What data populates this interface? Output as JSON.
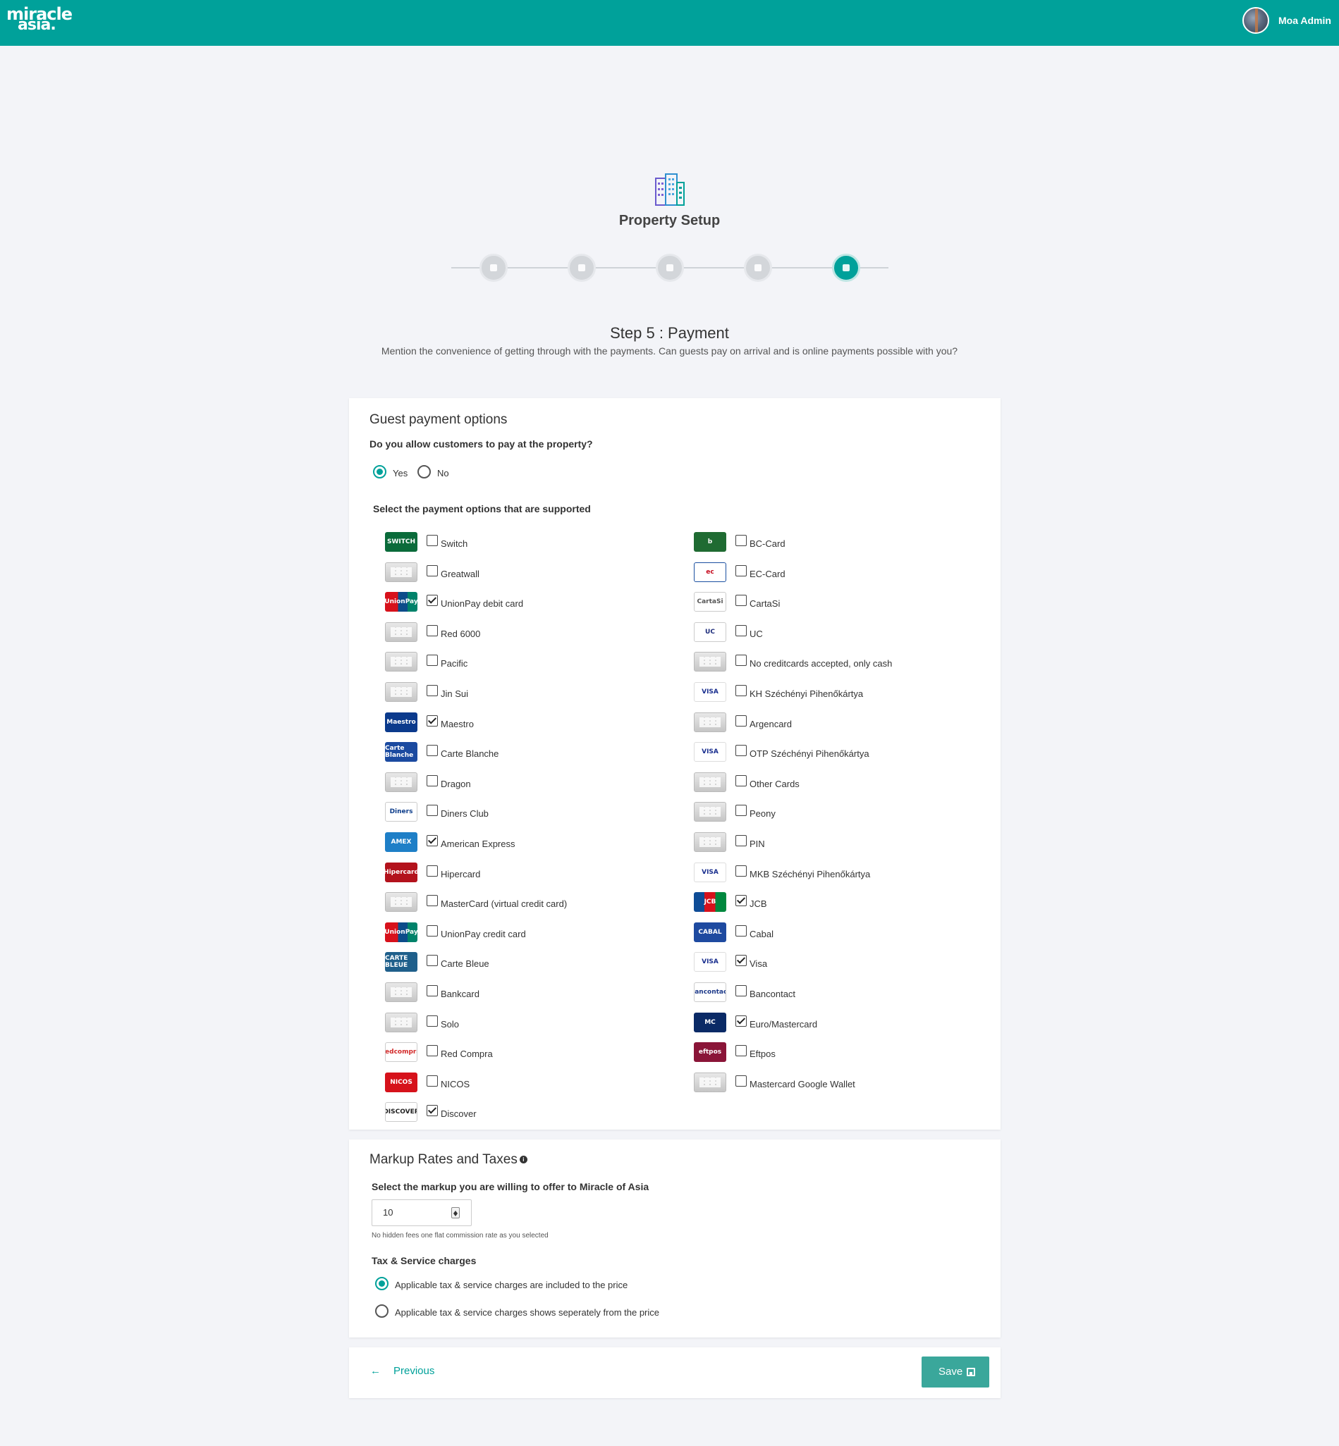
{
  "brand": {
    "logo_line1": "miracle",
    "logo_line2": "asia.",
    "accent": "#00a19a"
  },
  "user": {
    "name": "Moa Admin"
  },
  "page": {
    "title": "Property Setup"
  },
  "step": {
    "title": "Step 5 : Payment",
    "description": "Mention the convenience of getting through with the payments. Can guests pay on arrival and is online payments possible with you?"
  },
  "stepper": {
    "total": 5,
    "active": 5
  },
  "guest_payment": {
    "title": "Guest payment options",
    "question": "Do you allow customers to pay at the property?",
    "options": [
      {
        "label": "Yes",
        "selected": true
      },
      {
        "label": "No",
        "selected": false
      }
    ],
    "supported_label": "Select the payment options that are supported",
    "left_column": [
      {
        "label": "Switch",
        "checked": false,
        "icon": "switch-logo"
      },
      {
        "label": "Greatwall",
        "checked": false,
        "icon": "generic-card"
      },
      {
        "label": "UnionPay debit card",
        "checked": true,
        "icon": "unionpay-logo"
      },
      {
        "label": "Red 6000",
        "checked": false,
        "icon": "generic-card"
      },
      {
        "label": "Pacific",
        "checked": false,
        "icon": "generic-card"
      },
      {
        "label": "Jin Sui",
        "checked": false,
        "icon": "generic-card"
      },
      {
        "label": "Maestro",
        "checked": true,
        "icon": "maestro-logo"
      },
      {
        "label": "Carte Blanche",
        "checked": false,
        "icon": "carte-blanche-logo"
      },
      {
        "label": "Dragon",
        "checked": false,
        "icon": "generic-card"
      },
      {
        "label": "Diners Club",
        "checked": false,
        "icon": "diners-club-logo"
      },
      {
        "label": "American Express",
        "checked": true,
        "icon": "amex-logo"
      },
      {
        "label": "Hipercard",
        "checked": false,
        "icon": "hipercard-logo"
      },
      {
        "label": "MasterCard (virtual credit card)",
        "checked": false,
        "icon": "generic-card"
      },
      {
        "label": "UnionPay credit card",
        "checked": false,
        "icon": "unionpay-logo"
      },
      {
        "label": "Carte Bleue",
        "checked": false,
        "icon": "carte-bleue-logo"
      },
      {
        "label": "Bankcard",
        "checked": false,
        "icon": "generic-card"
      },
      {
        "label": "Solo",
        "checked": false,
        "icon": "generic-card"
      },
      {
        "label": "Red Compra",
        "checked": false,
        "icon": "redcompra-logo"
      },
      {
        "label": "NICOS",
        "checked": false,
        "icon": "nicos-logo"
      },
      {
        "label": "Discover",
        "checked": true,
        "icon": "discover-logo"
      }
    ],
    "right_column": [
      {
        "label": "BC-Card",
        "checked": false,
        "icon": "bc-card-logo"
      },
      {
        "label": "EC-Card",
        "checked": false,
        "icon": "ec-card-logo"
      },
      {
        "label": "CartaSi",
        "checked": false,
        "icon": "cartasi-logo"
      },
      {
        "label": "UC",
        "checked": false,
        "icon": "uc-logo"
      },
      {
        "label": "No creditcards accepted, only cash",
        "checked": false,
        "icon": "generic-card"
      },
      {
        "label": "KH Széchényi Pihenőkártya",
        "checked": false,
        "icon": "visa-logo"
      },
      {
        "label": "Argencard",
        "checked": false,
        "icon": "generic-card"
      },
      {
        "label": "OTP Széchényi Pihenőkártya",
        "checked": false,
        "icon": "visa-logo"
      },
      {
        "label": "Other Cards",
        "checked": false,
        "icon": "generic-card"
      },
      {
        "label": "Peony",
        "checked": false,
        "icon": "generic-card"
      },
      {
        "label": "PIN",
        "checked": false,
        "icon": "generic-card"
      },
      {
        "label": "MKB Széchényi Pihenőkártya",
        "checked": false,
        "icon": "visa-logo"
      },
      {
        "label": "JCB",
        "checked": true,
        "icon": "jcb-logo"
      },
      {
        "label": "Cabal",
        "checked": false,
        "icon": "cabal-logo"
      },
      {
        "label": "Visa",
        "checked": true,
        "icon": "visa-logo"
      },
      {
        "label": "Bancontact",
        "checked": false,
        "icon": "bancontact-logo"
      },
      {
        "label": "Euro/Mastercard",
        "checked": true,
        "icon": "mastercard-logo"
      },
      {
        "label": "Eftpos",
        "checked": false,
        "icon": "eftpos-logo"
      },
      {
        "label": "Mastercard Google Wallet",
        "checked": false,
        "icon": "generic-card"
      }
    ]
  },
  "markup": {
    "title": "Markup Rates and Taxes",
    "question": "Select the markup you are willing to offer to Miracle of Asia",
    "value": "10",
    "hint": "No hidden fees one flat commission rate as you selected",
    "tax_label": "Tax & Service charges",
    "tax_options": [
      {
        "label": "Applicable tax & service charges are included to the price",
        "selected": true
      },
      {
        "label": "Applicable tax & service charges shows seperately from the price",
        "selected": false
      }
    ]
  },
  "footer": {
    "previous_label": "Previous",
    "save_label": "Save"
  }
}
